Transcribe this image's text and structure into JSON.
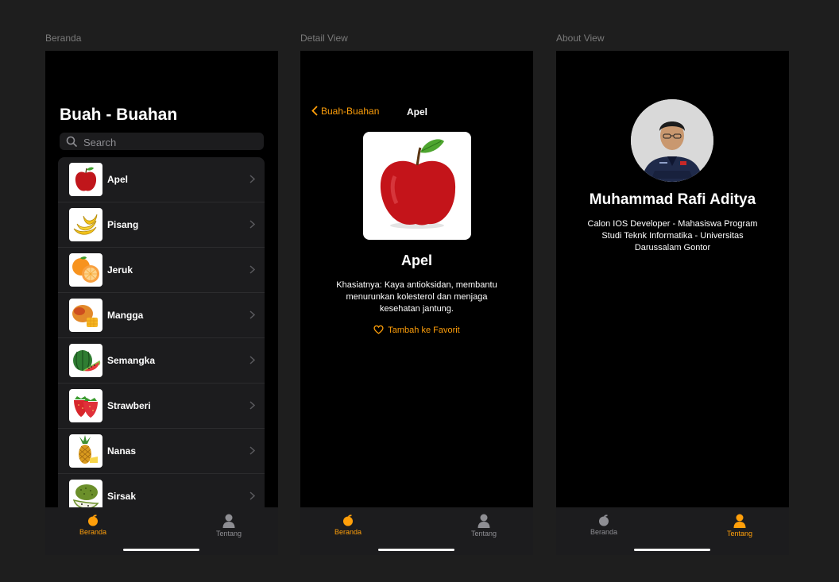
{
  "frames": {
    "beranda_label": "Beranda",
    "detail_label": "Detail View",
    "about_label": "About View"
  },
  "beranda": {
    "title": "Buah - Buahan",
    "search_placeholder": "Search",
    "fruits": [
      "Apel",
      "Pisang",
      "Jeruk",
      "Mangga",
      "Semangka",
      "Strawberi",
      "Nanas",
      "Sirsak"
    ]
  },
  "detail": {
    "back_label": "Buah-Buahan",
    "nav_title": "Apel",
    "title": "Apel",
    "description": "Khasiatnya: Kaya antioksidan, membantu menurunkan kolesterol dan menjaga kesehatan jantung.",
    "favorite_label": "Tambah ke Favorit"
  },
  "about": {
    "name": "Muhammad Rafi Aditya",
    "description": "Calon IOS Developer - Mahasiswa Program Studi Teknk Informatika - Universitas Darussalam Gontor"
  },
  "tabs": {
    "home_label": "Beranda",
    "about_label": "Tentang"
  },
  "colors": {
    "accent": "#ff9f0a",
    "background": "#000000",
    "surface": "#1c1c1e"
  }
}
